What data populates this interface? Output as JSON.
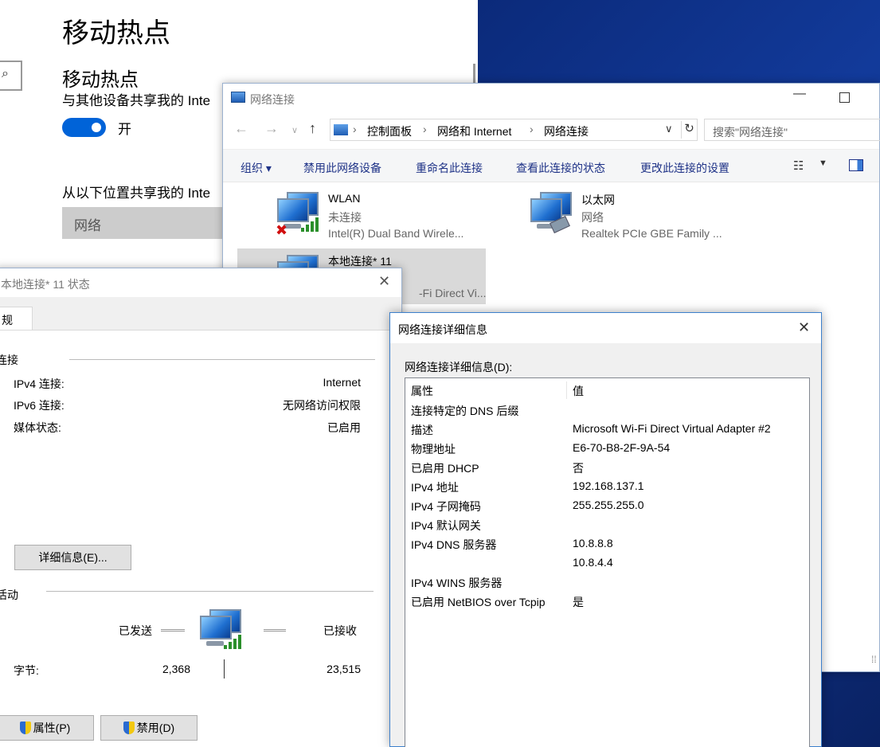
{
  "settings": {
    "page_title": "移动热点",
    "section_title": "移动热点",
    "share_desc": "与其他设备共享我的 Inte",
    "toggle_label": "开",
    "share_from_label": "从以下位置共享我的 Inte",
    "dropdown_value": "网络",
    "search_icon": "⌕"
  },
  "netwin": {
    "title": "网络连接",
    "breadcrumbs": [
      "控制面板",
      "网络和 Internet",
      "网络连接"
    ],
    "search_placeholder": "搜索\"网络连接\"",
    "toolbar": {
      "organize": "组织 ▾",
      "disable": "禁用此网络设备",
      "rename": "重命名此连接",
      "view_status": "查看此连接的状态",
      "change_settings": "更改此连接的设置"
    },
    "connections": [
      {
        "name": "WLAN",
        "status": "未连接",
        "device": "Intel(R) Dual Band Wirele..."
      },
      {
        "name": "以太网",
        "status": "网络",
        "device": "Realtek PCIe GBE Family ..."
      },
      {
        "name": "本地连接* 11",
        "status": "",
        "device": "-Fi Direct Vi..."
      }
    ]
  },
  "status_dialog": {
    "title": "本地连接* 11 状态",
    "tab": "规",
    "connection_group": "连接",
    "rows": [
      {
        "label": "IPv4 连接:",
        "value": "Internet"
      },
      {
        "label": "IPv6 连接:",
        "value": "无网络访问权限"
      },
      {
        "label": "媒体状态:",
        "value": "已启用"
      }
    ],
    "details_button": "详细信息(E)...",
    "activity_group": "活动",
    "sent_label": "已发送",
    "received_label": "已接收",
    "bytes_label": "字节:",
    "bytes_sent": "2,368",
    "bytes_received": "23,515",
    "properties_button": "属性(P)",
    "disable_button": "禁用(D)"
  },
  "details_dialog": {
    "title": "网络连接详细信息",
    "label": "网络连接详细信息(D):",
    "col_property": "属性",
    "col_value": "值",
    "rows": [
      {
        "p": "连接特定的 DNS 后缀",
        "v": ""
      },
      {
        "p": "描述",
        "v": "Microsoft Wi-Fi Direct Virtual Adapter #2"
      },
      {
        "p": "物理地址",
        "v": "E6-70-B8-2F-9A-54"
      },
      {
        "p": "已启用 DHCP",
        "v": "否"
      },
      {
        "p": "IPv4 地址",
        "v": "192.168.137.1"
      },
      {
        "p": "IPv4 子网掩码",
        "v": "255.255.255.0"
      },
      {
        "p": "IPv4 默认网关",
        "v": ""
      },
      {
        "p": "IPv4 DNS 服务器",
        "v": "10.8.8.8"
      },
      {
        "p": "",
        "v": "10.8.4.4"
      },
      {
        "p": "IPv4 WINS 服务器",
        "v": ""
      },
      {
        "p": "已启用 NetBIOS over Tcpip",
        "v": "是"
      }
    ]
  },
  "colors": {
    "accent": "#0063d8",
    "toolbar_text": "#1e3287",
    "selection": "#d9d9d9",
    "desktop": "#123a9a"
  }
}
